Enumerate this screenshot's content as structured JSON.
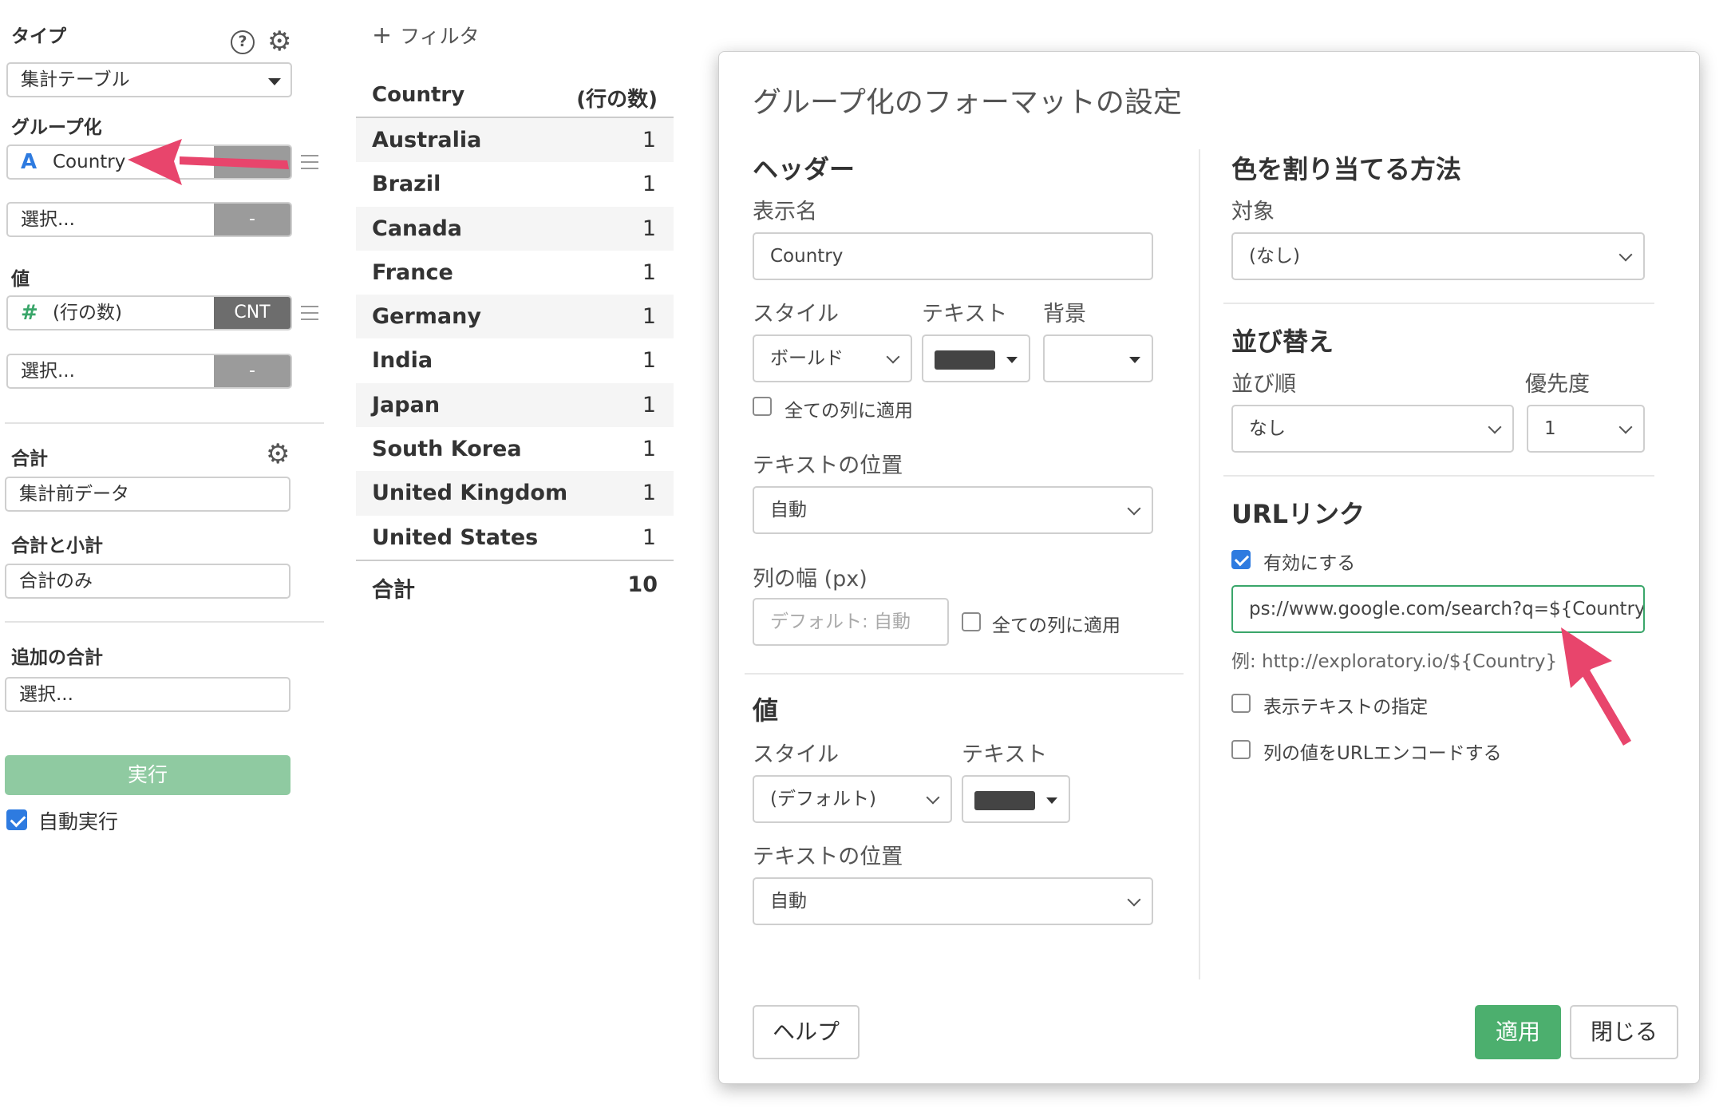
{
  "left_panel": {
    "type_label": "タイプ",
    "type_value": "集計テーブル",
    "group_label": "グループ化",
    "group_field": "Country",
    "group_field_icon": "A",
    "group_select_placeholder": "選択...",
    "group_select_agg": "-",
    "value_label": "値",
    "value_field": "(行の数)",
    "value_field_icon": "#",
    "value_agg": "CNT",
    "value_select_placeholder": "選択...",
    "value_select_agg": "-",
    "total_label": "合計",
    "total_value": "集計前データ",
    "subtotal_label": "合計と小計",
    "subtotal_value": "合計のみ",
    "extra_total_label": "追加の合計",
    "extra_total_placeholder": "選択...",
    "run_button": "実行",
    "auto_run_label": "自動実行",
    "auto_run_checked": true
  },
  "filter_label": "フィルタ",
  "table": {
    "headers": [
      "Country",
      "(行の数)"
    ],
    "rows": [
      {
        "country": "Australia",
        "count": "1"
      },
      {
        "country": "Brazil",
        "count": "1"
      },
      {
        "country": "Canada",
        "count": "1"
      },
      {
        "country": "France",
        "count": "1"
      },
      {
        "country": "Germany",
        "count": "1"
      },
      {
        "country": "India",
        "count": "1"
      },
      {
        "country": "Japan",
        "count": "1"
      },
      {
        "country": "South Korea",
        "count": "1"
      },
      {
        "country": "United Kingdom",
        "count": "1"
      },
      {
        "country": "United States",
        "count": "1"
      }
    ],
    "total_label": "合計",
    "total_value": "10"
  },
  "dialog": {
    "title": "グループ化のフォーマットの設定",
    "header_section": {
      "title": "ヘッダー",
      "display_name_label": "表示名",
      "display_name_value": "Country",
      "style_label": "スタイル",
      "text_label": "テキスト",
      "bg_label": "背景",
      "style_value": "ボールド",
      "apply_all_label": "全ての列に適用",
      "text_pos_label": "テキストの位置",
      "text_pos_value": "自動",
      "col_width_label": "列の幅 (px)",
      "col_width_placeholder": "デフォルト: 自動",
      "col_width_apply_all_label": "全ての列に適用"
    },
    "value_section": {
      "title": "値",
      "style_label": "スタイル",
      "text_label": "テキスト",
      "style_value": "(デフォルト)",
      "text_pos_label": "テキストの位置",
      "text_pos_value": "自動"
    },
    "color_section": {
      "title": "色を割り当てる方法",
      "target_label": "対象",
      "target_value": "(なし)"
    },
    "sort_section": {
      "title": "並び替え",
      "order_label": "並び順",
      "priority_label": "優先度",
      "order_value": "なし",
      "priority_value": "1"
    },
    "url_section": {
      "title": "URLリンク",
      "enable_label": "有効にする",
      "enable_checked": true,
      "url_value": "ps://www.google.com/search?q=${Country}",
      "example": "例: http://exploratory.io/${Country}",
      "display_text_label": "表示テキストの指定",
      "url_encode_label": "列の値をURLエンコードする"
    },
    "help_button": "ヘルプ",
    "apply_button": "適用",
    "close_button": "閉じる"
  },
  "colors": {
    "accent_green": "#4caf6e",
    "run_green": "#8fcaa1",
    "checkbox_blue": "#2e7be0",
    "annotation_arrow": "#e8456c",
    "color_swatch": "#444444"
  }
}
